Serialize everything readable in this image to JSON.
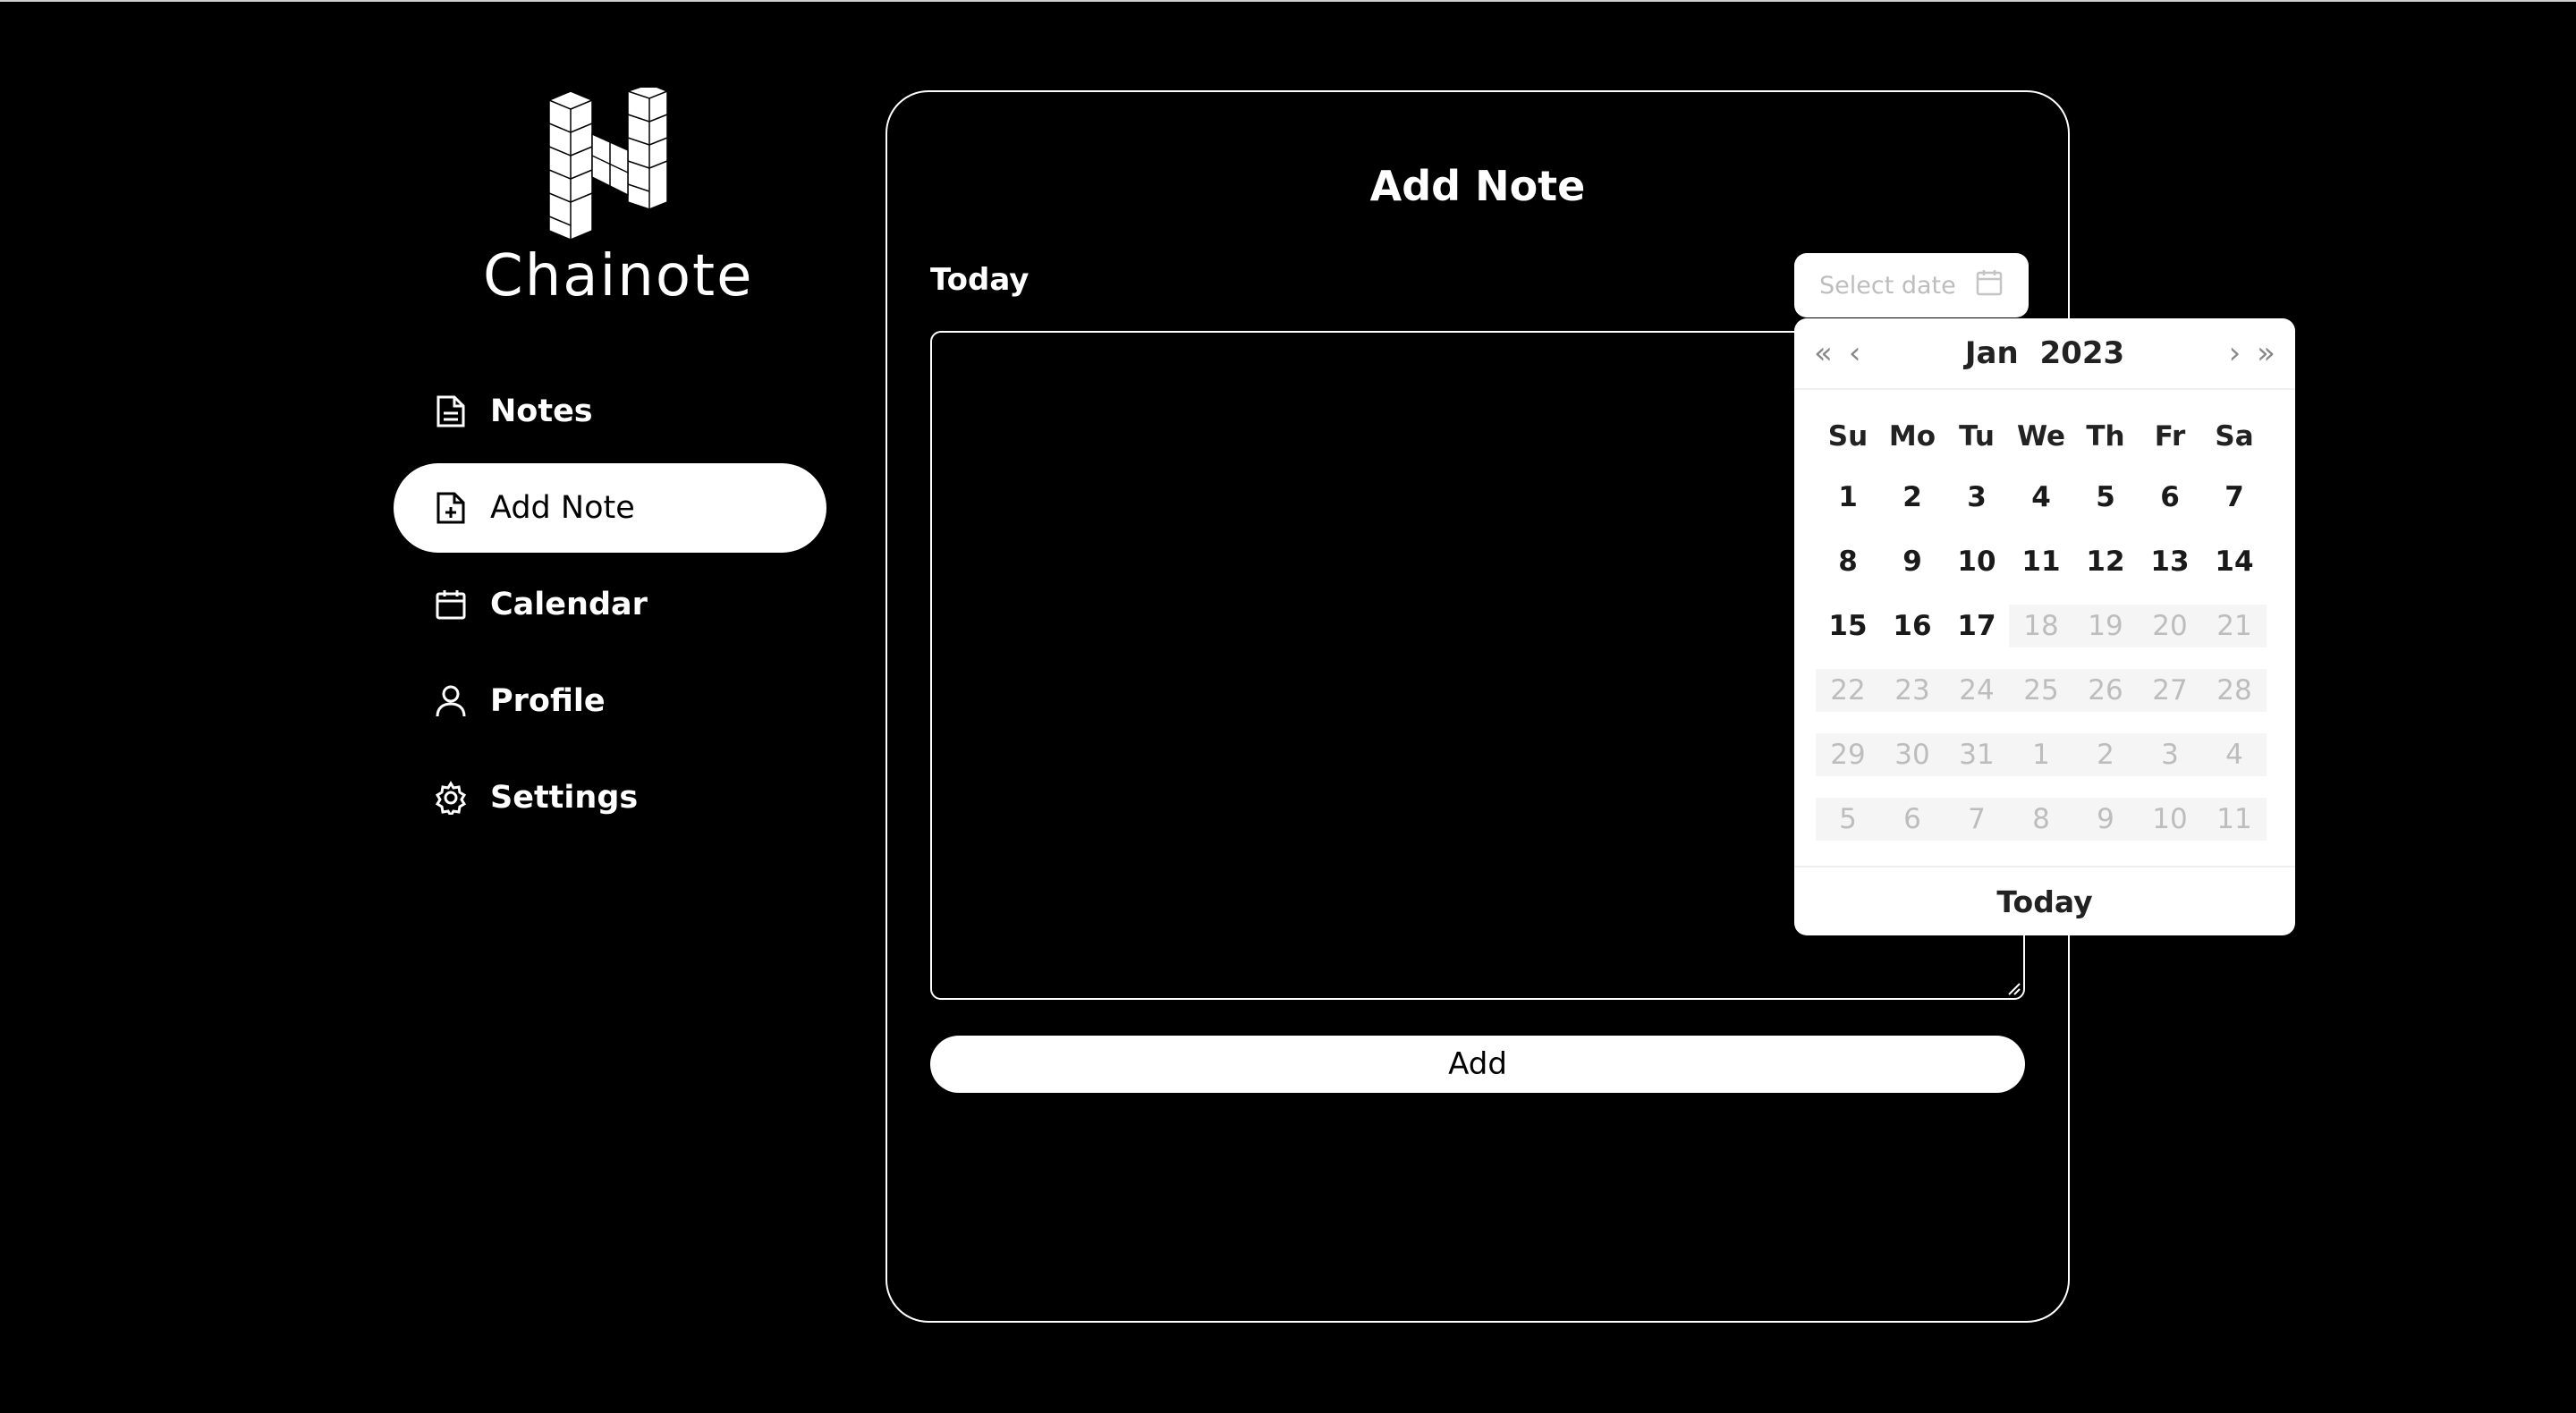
{
  "sidebar": {
    "brand": "Chainote",
    "items": [
      {
        "label": "Notes",
        "icon": "file-icon",
        "active": false
      },
      {
        "label": "Add Note",
        "icon": "file-plus-icon",
        "active": true
      },
      {
        "label": "Calendar",
        "icon": "calendar-icon",
        "active": false
      },
      {
        "label": "Profile",
        "icon": "user-icon",
        "active": false
      },
      {
        "label": "Settings",
        "icon": "gear-icon",
        "active": false
      }
    ]
  },
  "main": {
    "title": "Add Note",
    "date_label": "Today",
    "date_placeholder": "Select date",
    "note_value": "",
    "add_label": "Add"
  },
  "datepicker": {
    "month": "Jan",
    "year": "2023",
    "prev_year": "«",
    "prev_month": "‹",
    "next_month": "›",
    "next_year": "»",
    "weekdays": [
      "Su",
      "Mo",
      "Tu",
      "We",
      "Th",
      "Fr",
      "Sa"
    ],
    "weeks": [
      [
        [
          "1",
          0
        ],
        [
          "2",
          0
        ],
        [
          "3",
          0
        ],
        [
          "4",
          0
        ],
        [
          "5",
          0
        ],
        [
          "6",
          0
        ],
        [
          "7",
          0
        ]
      ],
      [
        [
          "8",
          0
        ],
        [
          "9",
          0
        ],
        [
          "10",
          0
        ],
        [
          "11",
          0
        ],
        [
          "12",
          0
        ],
        [
          "13",
          0
        ],
        [
          "14",
          0
        ]
      ],
      [
        [
          "15",
          0
        ],
        [
          "16",
          0
        ],
        [
          "17",
          0
        ],
        [
          "18",
          1
        ],
        [
          "19",
          1
        ],
        [
          "20",
          1
        ],
        [
          "21",
          1
        ]
      ],
      [
        [
          "22",
          1
        ],
        [
          "23",
          1
        ],
        [
          "24",
          1
        ],
        [
          "25",
          1
        ],
        [
          "26",
          1
        ],
        [
          "27",
          1
        ],
        [
          "28",
          1
        ]
      ],
      [
        [
          "29",
          1
        ],
        [
          "30",
          1
        ],
        [
          "31",
          1
        ],
        [
          "1",
          1
        ],
        [
          "2",
          1
        ],
        [
          "3",
          1
        ],
        [
          "4",
          1
        ]
      ],
      [
        [
          "5",
          1
        ],
        [
          "6",
          1
        ],
        [
          "7",
          1
        ],
        [
          "8",
          1
        ],
        [
          "9",
          1
        ],
        [
          "10",
          1
        ],
        [
          "11",
          1
        ]
      ]
    ],
    "today_label": "Today"
  },
  "colors": {
    "background": "#000000",
    "foreground": "#ffffff",
    "disabled": "#bdbdbd"
  }
}
